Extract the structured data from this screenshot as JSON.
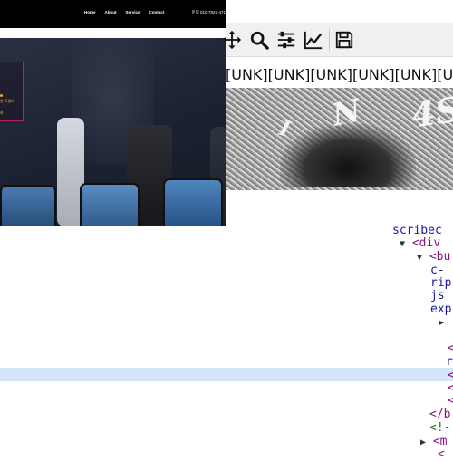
{
  "site": {
    "nav_links": [
      "Home",
      "About",
      "Service",
      "Contact"
    ],
    "phone": "문의 010-7922-471",
    "hero_line1": "한 특별가",
    "hero_line2": "라"
  },
  "toolbar": {
    "icons": [
      "move-icon",
      "zoom-icon",
      "sliders-icon",
      "chart-line-icon",
      "save-icon"
    ]
  },
  "unk_text": "[UNK][UNK][UNK][UNK][UNK][UNK]",
  "noise_image": {
    "glyph1": "N",
    "glyph2": "4S",
    "glyph3": "Ⅰ"
  },
  "devtools": {
    "rows": [
      {
        "text": "scribec",
        "cls": "attr"
      },
      {
        "text": "<div",
        "cls": "tag",
        "tri": "▼"
      },
      {
        "text": "<bu",
        "cls": "tag",
        "tri": "▼"
      },
      {
        "text": "c-",
        "cls": "attr"
      },
      {
        "text": "rip",
        "cls": "attr"
      },
      {
        "text": "js",
        "cls": "attr"
      },
      {
        "text": "exp",
        "cls": "attr"
      },
      {
        "text": "",
        "cls": "tag",
        "tri": "▶"
      },
      {
        "text": "",
        "cls": "tag"
      },
      {
        "text": "<",
        "cls": "tag"
      },
      {
        "text": "r",
        "cls": "attr"
      },
      {
        "text": "<",
        "cls": "tag"
      },
      {
        "text": "<",
        "cls": "tag"
      },
      {
        "text": "<",
        "cls": "tag"
      },
      {
        "text": "</b",
        "cls": "tag"
      },
      {
        "text": "<!-",
        "cls": "cmt"
      },
      {
        "text": "<m",
        "cls": "tag",
        "tri": "▶"
      },
      {
        "text": "<",
        "cls": "tag"
      }
    ]
  }
}
